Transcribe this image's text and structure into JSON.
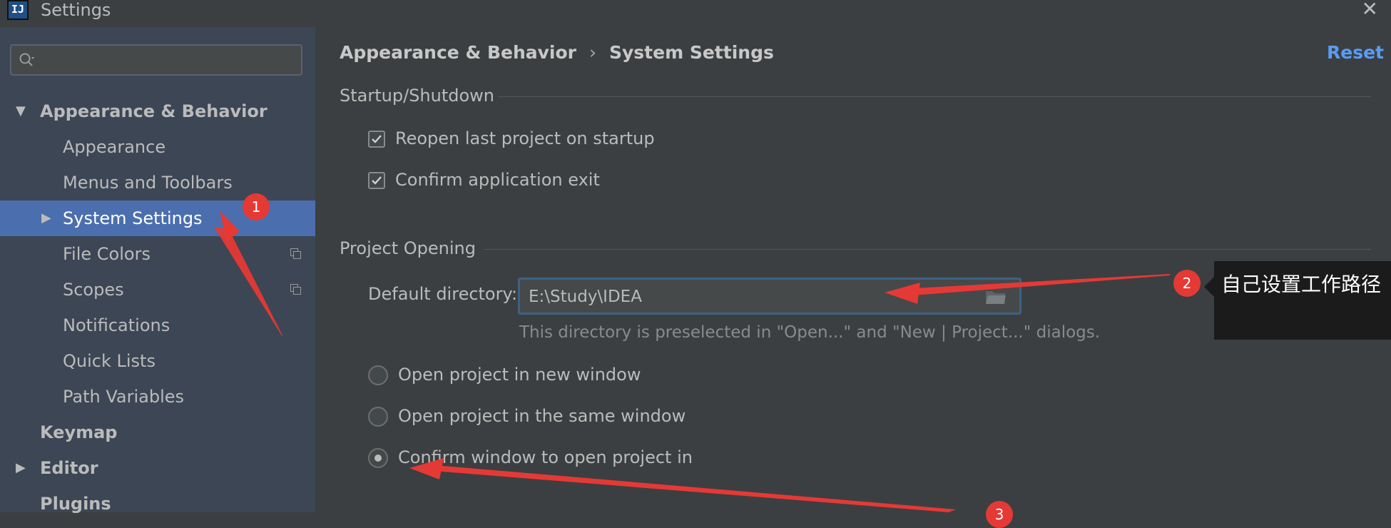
{
  "window": {
    "title": "Settings",
    "app_icon_text": "IJ"
  },
  "sidebar": {
    "search_placeholder": "",
    "items": [
      {
        "label": "Appearance & Behavior",
        "level": 0,
        "expanded": true
      },
      {
        "label": "Appearance",
        "level": 1
      },
      {
        "label": "Menus and Toolbars",
        "level": 1
      },
      {
        "label": "System Settings",
        "level": 1,
        "selected": true,
        "has_children": true
      },
      {
        "label": "File Colors",
        "level": 1,
        "icon": "copy-icon"
      },
      {
        "label": "Scopes",
        "level": 1,
        "icon": "copy-icon"
      },
      {
        "label": "Notifications",
        "level": 1
      },
      {
        "label": "Quick Lists",
        "level": 1
      },
      {
        "label": "Path Variables",
        "level": 1
      },
      {
        "label": "Keymap",
        "level": 0
      },
      {
        "label": "Editor",
        "level": 0,
        "has_children": true
      },
      {
        "label": "Plugins",
        "level": 0
      }
    ]
  },
  "main": {
    "breadcrumb": [
      "Appearance & Behavior",
      "System Settings"
    ],
    "breadcrumb_separator": "›",
    "reset_label": "Reset",
    "startup": {
      "title": "Startup/Shutdown",
      "reopen_label": "Reopen last project on startup",
      "reopen_checked": true,
      "confirm_exit_label": "Confirm application exit",
      "confirm_exit_checked": true
    },
    "project_opening": {
      "title": "Project Opening",
      "default_dir_label": "Default directory:",
      "default_dir_value": "E:\\Study\\IDEA",
      "hint": "This directory is preselected in \"Open...\" and \"New | Project...\" dialogs.",
      "radios": [
        {
          "label": "Open project in new window",
          "checked": false
        },
        {
          "label": "Open project in the same window",
          "checked": false
        },
        {
          "label": "Confirm window to open project in",
          "checked": true
        }
      ]
    }
  },
  "annotations": {
    "badge_1": "1",
    "badge_2": "2",
    "badge_3": "3",
    "callout_text": "自己设置工作路径",
    "color": "#e53935"
  },
  "colors": {
    "sidebar_bg": "#3c4655",
    "selected_bg": "#4b6eaf",
    "main_bg": "#3c3f41",
    "link": "#589df6"
  }
}
